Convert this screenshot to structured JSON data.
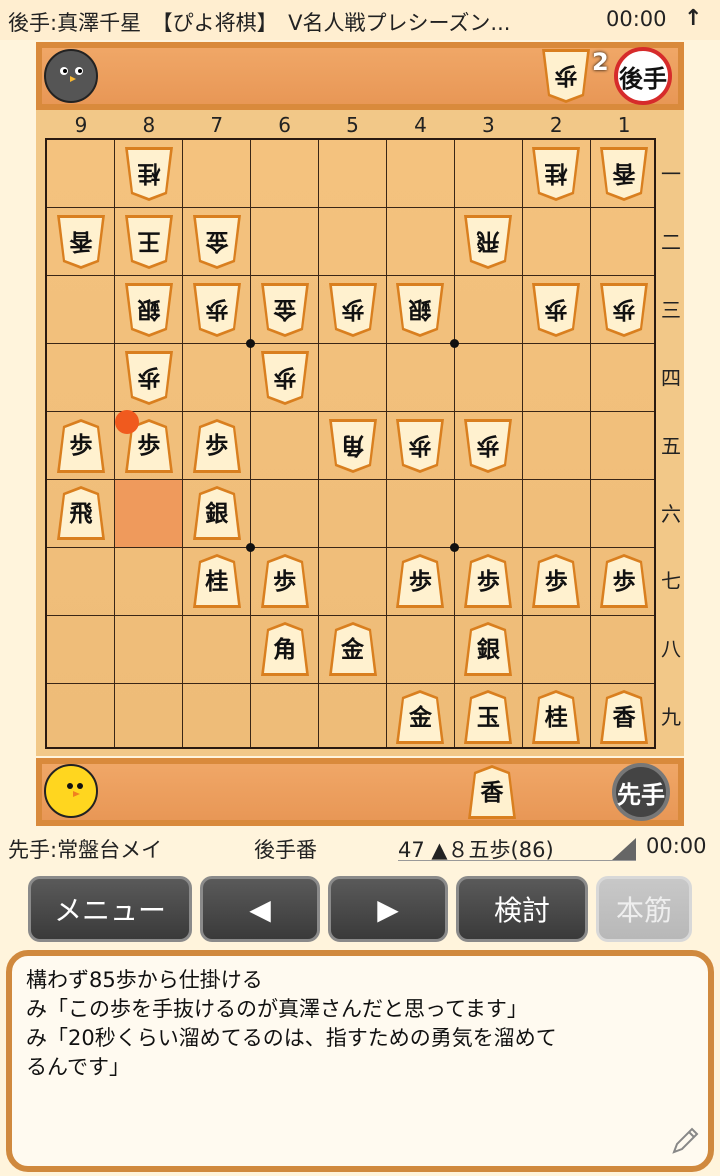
{
  "header": {
    "title": "後手:真澤千星　【ぴよ将棋】　V名人戦プレシーズン...",
    "clock": "00:00",
    "up_icon": "arrow-up-icon"
  },
  "gote": {
    "name": "真澤千星",
    "badge": "後手",
    "hand": [
      {
        "piece": "歩",
        "count": "2"
      }
    ]
  },
  "sente": {
    "name": "常盤台メイ",
    "badge": "先手",
    "hand": [
      {
        "piece": "香",
        "count": ""
      }
    ]
  },
  "file_labels": [
    "9",
    "8",
    "7",
    "6",
    "5",
    "4",
    "3",
    "2",
    "1"
  ],
  "rank_labels": [
    "一",
    "二",
    "三",
    "四",
    "五",
    "六",
    "七",
    "八",
    "九"
  ],
  "board": [
    {
      "file": 8,
      "rank": 1,
      "piece": "桂",
      "owner": "gote"
    },
    {
      "file": 2,
      "rank": 1,
      "piece": "桂",
      "owner": "gote"
    },
    {
      "file": 1,
      "rank": 1,
      "piece": "香",
      "owner": "gote"
    },
    {
      "file": 9,
      "rank": 2,
      "piece": "香",
      "owner": "gote"
    },
    {
      "file": 8,
      "rank": 2,
      "piece": "王",
      "owner": "gote"
    },
    {
      "file": 7,
      "rank": 2,
      "piece": "金",
      "owner": "gote"
    },
    {
      "file": 3,
      "rank": 2,
      "piece": "飛",
      "owner": "gote"
    },
    {
      "file": 8,
      "rank": 3,
      "piece": "銀",
      "owner": "gote"
    },
    {
      "file": 7,
      "rank": 3,
      "piece": "歩",
      "owner": "gote"
    },
    {
      "file": 6,
      "rank": 3,
      "piece": "金",
      "owner": "gote"
    },
    {
      "file": 5,
      "rank": 3,
      "piece": "歩",
      "owner": "gote"
    },
    {
      "file": 4,
      "rank": 3,
      "piece": "銀",
      "owner": "gote"
    },
    {
      "file": 2,
      "rank": 3,
      "piece": "歩",
      "owner": "gote"
    },
    {
      "file": 1,
      "rank": 3,
      "piece": "歩",
      "owner": "gote"
    },
    {
      "file": 8,
      "rank": 4,
      "piece": "歩",
      "owner": "gote"
    },
    {
      "file": 6,
      "rank": 4,
      "piece": "歩",
      "owner": "gote"
    },
    {
      "file": 9,
      "rank": 5,
      "piece": "歩",
      "owner": "sente"
    },
    {
      "file": 8,
      "rank": 5,
      "piece": "歩",
      "owner": "sente"
    },
    {
      "file": 7,
      "rank": 5,
      "piece": "歩",
      "owner": "sente"
    },
    {
      "file": 5,
      "rank": 5,
      "piece": "角",
      "owner": "gote"
    },
    {
      "file": 4,
      "rank": 5,
      "piece": "歩",
      "owner": "gote"
    },
    {
      "file": 3,
      "rank": 5,
      "piece": "歩",
      "owner": "gote"
    },
    {
      "file": 9,
      "rank": 6,
      "piece": "飛",
      "owner": "sente"
    },
    {
      "file": 7,
      "rank": 6,
      "piece": "銀",
      "owner": "sente"
    },
    {
      "file": 7,
      "rank": 7,
      "piece": "桂",
      "owner": "sente"
    },
    {
      "file": 6,
      "rank": 7,
      "piece": "歩",
      "owner": "sente"
    },
    {
      "file": 4,
      "rank": 7,
      "piece": "歩",
      "owner": "sente"
    },
    {
      "file": 3,
      "rank": 7,
      "piece": "歩",
      "owner": "sente"
    },
    {
      "file": 2,
      "rank": 7,
      "piece": "歩",
      "owner": "sente"
    },
    {
      "file": 1,
      "rank": 7,
      "piece": "歩",
      "owner": "sente"
    },
    {
      "file": 6,
      "rank": 8,
      "piece": "角",
      "owner": "sente"
    },
    {
      "file": 5,
      "rank": 8,
      "piece": "金",
      "owner": "sente"
    },
    {
      "file": 3,
      "rank": 8,
      "piece": "銀",
      "owner": "sente"
    },
    {
      "file": 4,
      "rank": 9,
      "piece": "金",
      "owner": "sente"
    },
    {
      "file": 3,
      "rank": 9,
      "piece": "玉",
      "owner": "sente"
    },
    {
      "file": 2,
      "rank": 9,
      "piece": "桂",
      "owner": "sente"
    },
    {
      "file": 1,
      "rank": 9,
      "piece": "香",
      "owner": "sente"
    }
  ],
  "last_move": {
    "from": {
      "file": 8,
      "rank": 6
    },
    "to": {
      "file": 8,
      "rank": 5
    }
  },
  "colors": {
    "tray_border": "#d98a3c",
    "piece_face": "#fff1cf",
    "piece_edge": "#d97f1f",
    "last_move_from": "#ef9a5c",
    "last_move_dot": "#f05a1e"
  },
  "info": {
    "sente_label": "先手:常盤台メイ",
    "turn_label": "後手番",
    "move_label": "47 ▲８五歩(86)",
    "clock": "00:00"
  },
  "buttons": {
    "menu": "メニュー",
    "prev": "◀",
    "next": "▶",
    "review": "検討",
    "mainline": "本筋"
  },
  "comment": {
    "lines": [
      "構わず85歩から仕掛ける",
      "み「この歩を手抜けるのが真澤さんだと思ってます」",
      "み「20秒くらい溜めてるのは、指すための勇気を溜めて\nるんです」"
    ],
    "edit_icon": "pencil-icon"
  }
}
